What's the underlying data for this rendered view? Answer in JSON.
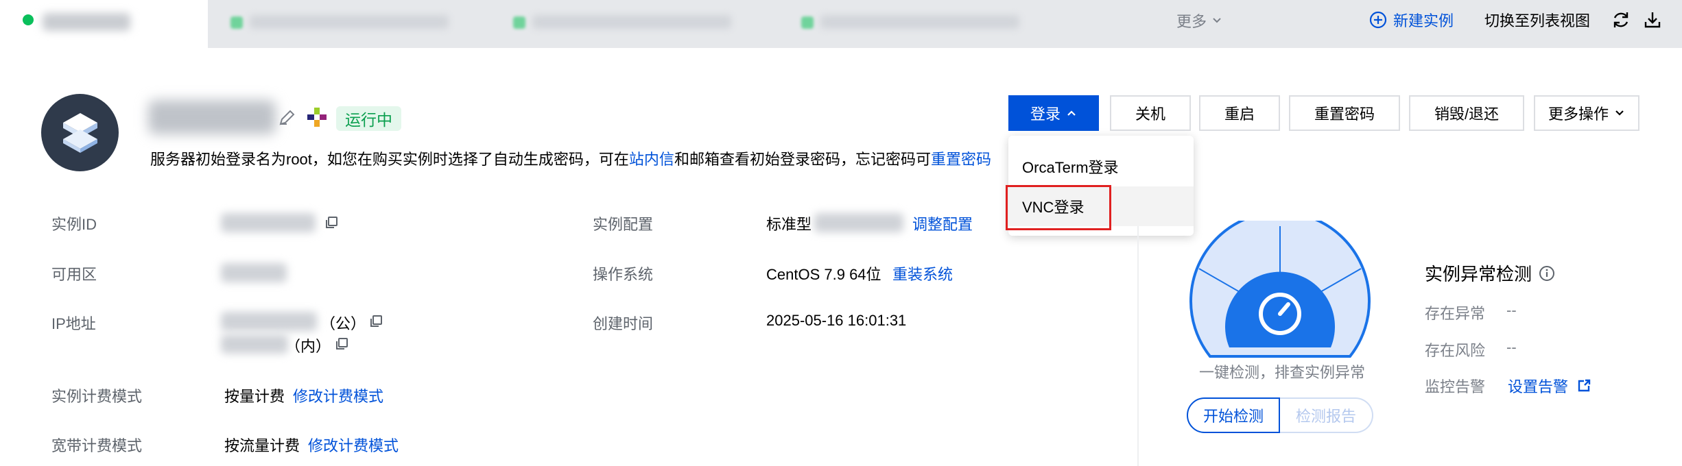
{
  "colors": {
    "brand": "#0052d9",
    "running": "#0a9f4e",
    "alert_outline": "#e02020"
  },
  "topbar": {
    "more_label": "更多",
    "new_instance_label": "新建实例",
    "switch_view_label": "切换至列表视图",
    "refresh_icon": "refresh-icon",
    "download_icon": "download-icon"
  },
  "header": {
    "status_badge": "运行中",
    "tip_prefix": "服务器初始登录名为root，如您在购买实例时选择了自动生成密码，可在",
    "tip_link1": "站内信",
    "tip_middle": "和邮箱查看初始登录密码，忘记密码可",
    "tip_link2": "重置密码"
  },
  "actions": {
    "login": "登录",
    "shutdown": "关机",
    "restart": "重启",
    "reset_password": "重置密码",
    "destroy": "销毁/退还",
    "more_actions": "更多操作"
  },
  "login_menu": {
    "items": [
      "OrcaTerm登录",
      "VNC登录"
    ]
  },
  "info": {
    "instance_id_label": "实例ID",
    "zone_label": "可用区",
    "ip_label": "IP地址",
    "ip_public_suffix": "（公）",
    "ip_private_suffix": "（内）",
    "billing_label": "实例计费模式",
    "billing_value": "按量计费",
    "billing_link": "修改计费模式",
    "bandwidth_label": "宽带计费模式",
    "bandwidth_value": "按流量计费",
    "bandwidth_link": "修改计费模式",
    "config_label": "实例配置",
    "config_value": "标准型",
    "config_link": "调整配置",
    "os_label": "操作系统",
    "os_value": "CentOS 7.9 64位",
    "os_link": "重装系统",
    "created_label": "创建时间",
    "created_value": "2025-05-16 16:01:31"
  },
  "detection": {
    "caption": "一键检测，排查实例异常",
    "start_button": "开始检测",
    "report_button": "检测报告",
    "title": "实例异常检测",
    "exception_label": "存在异常",
    "exception_value": "--",
    "risk_label": "存在风险",
    "risk_value": "--",
    "monitor_label": "监控告警",
    "monitor_link": "设置告警"
  }
}
